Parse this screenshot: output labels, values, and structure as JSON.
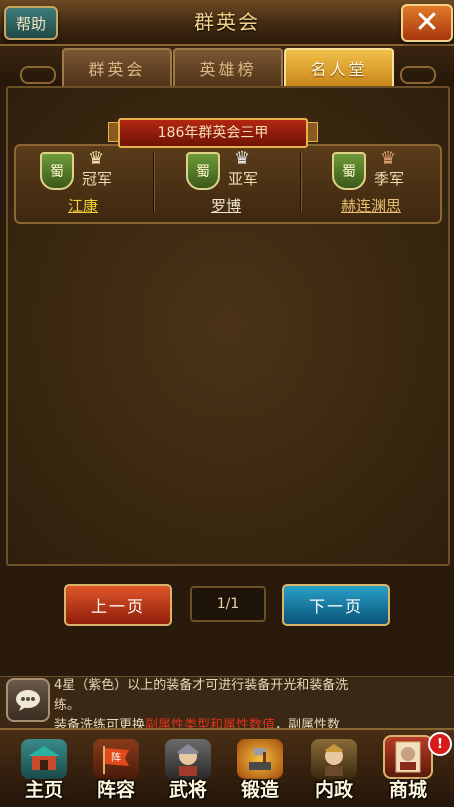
{
  "header": {
    "title": "群英会",
    "help_label": "帮助",
    "close_glyph": "✕"
  },
  "tabs": [
    {
      "label": "群英会",
      "active": false
    },
    {
      "label": "英雄榜",
      "active": false
    },
    {
      "label": "名人堂",
      "active": true
    }
  ],
  "hall": {
    "ribbon": "186年群英会三甲",
    "winners": [
      {
        "faction": "蜀",
        "rank": "冠军",
        "name": "江康",
        "name_color": "#f2d23a",
        "crown_color": "#f5e7b0"
      },
      {
        "faction": "蜀",
        "rank": "亚军",
        "name": "罗博",
        "name_color": "#f0e6d0",
        "crown_color": "#e8e8f0"
      },
      {
        "faction": "蜀",
        "rank": "季军",
        "name": "赫连渊思",
        "name_color": "#e8c070",
        "crown_color": "#e0a070"
      }
    ]
  },
  "pager": {
    "prev_label": "上一页",
    "page": "1/1",
    "next_label": "下一页"
  },
  "chat": {
    "line1": "4星（紫色）以上的装备才可进行装备开光和装备洗",
    "line2": "练。",
    "line3_a": "装备洗练可更换",
    "line3_red": "副属性类型和属性数值",
    "line3_b": "，副属性数"
  },
  "nav": {
    "items": [
      {
        "label": "主页",
        "icon": "pavilion-icon"
      },
      {
        "label": "阵容",
        "icon": "banner-icon"
      },
      {
        "label": "武将",
        "icon": "general-icon"
      },
      {
        "label": "锻造",
        "icon": "forge-icon"
      },
      {
        "label": "内政",
        "icon": "advisor-icon"
      },
      {
        "label": "商城",
        "icon": "shop-card-icon"
      }
    ],
    "shop_badge": "!"
  },
  "colors": {
    "accent": "#f2c04a",
    "brand_red": "#b32612",
    "brand_teal": "#2aa0c8"
  }
}
